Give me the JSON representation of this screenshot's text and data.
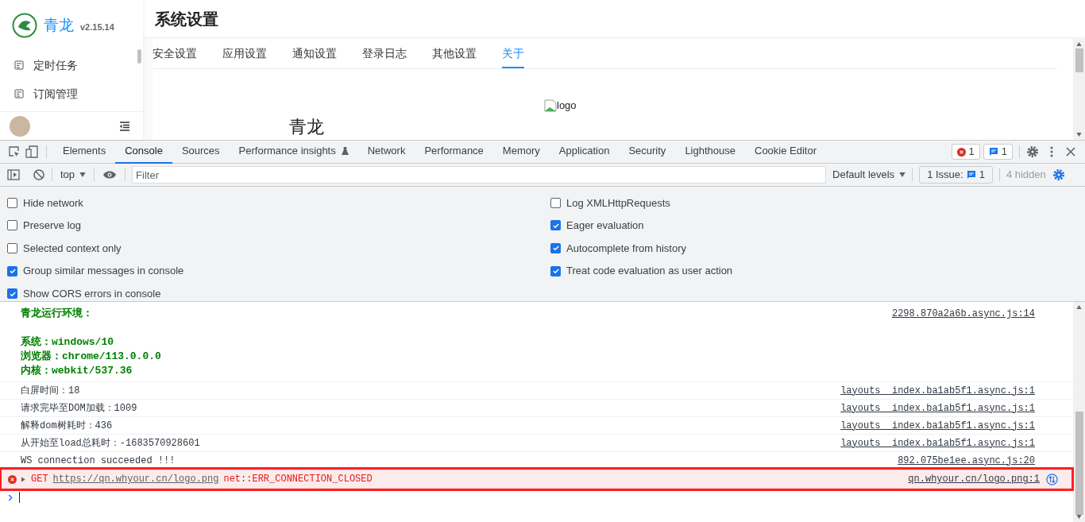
{
  "app": {
    "logo_text": "青龙",
    "version": "v2.15.14",
    "nav": [
      {
        "label": "定时任务"
      },
      {
        "label": "订阅管理"
      }
    ],
    "page_title": "系统设置",
    "tabs": [
      {
        "label": "安全设置",
        "selected": false
      },
      {
        "label": "应用设置",
        "selected": false
      },
      {
        "label": "通知设置",
        "selected": false
      },
      {
        "label": "登录日志",
        "selected": false
      },
      {
        "label": "其他设置",
        "selected": false
      },
      {
        "label": "关于",
        "selected": true
      }
    ],
    "content": {
      "image_alt": "logo",
      "heading": "青龙"
    }
  },
  "devtools": {
    "tabs": [
      {
        "label": "Elements",
        "selected": false
      },
      {
        "label": "Console",
        "selected": true
      },
      {
        "label": "Sources",
        "selected": false
      },
      {
        "label": "Performance insights",
        "selected": false,
        "experimental": true
      },
      {
        "label": "Network",
        "selected": false
      },
      {
        "label": "Performance",
        "selected": false
      },
      {
        "label": "Memory",
        "selected": false
      },
      {
        "label": "Application",
        "selected": false
      },
      {
        "label": "Security",
        "selected": false
      },
      {
        "label": "Lighthouse",
        "selected": false
      },
      {
        "label": "Cookie Editor",
        "selected": false
      }
    ],
    "error_count": "1",
    "message_count": "1",
    "toolbar": {
      "context": "top",
      "filter_placeholder": "Filter",
      "levels": "Default levels",
      "issues_label": "1 Issue:",
      "issues_count": "1",
      "hidden": "4 hidden"
    },
    "settings_left": [
      {
        "label": "Hide network",
        "checked": false
      },
      {
        "label": "Preserve log",
        "checked": false
      },
      {
        "label": "Selected context only",
        "checked": false
      },
      {
        "label": "Group similar messages in console",
        "checked": true
      },
      {
        "label": "Show CORS errors in console",
        "checked": true
      }
    ],
    "settings_right": [
      {
        "label": "Log XMLHttpRequests",
        "checked": false
      },
      {
        "label": "Eager evaluation",
        "checked": true
      },
      {
        "label": "Autocomplete from history",
        "checked": true
      },
      {
        "label": "Treat code evaluation as user action",
        "checked": true
      }
    ],
    "messages": [
      {
        "kind": "env",
        "lines": [
          "青龙运行环境：",
          "系统：windows/10",
          "浏览器：chrome/113.0.0.0",
          "内核：webkit/537.36"
        ],
        "source": "2298.870a2a6b.async.js:14"
      },
      {
        "kind": "log",
        "text": "白屏时间：18",
        "source": "layouts__index.ba1ab5f1.async.js:1"
      },
      {
        "kind": "log",
        "text": "请求完毕至DOM加载：1009",
        "source": "layouts__index.ba1ab5f1.async.js:1"
      },
      {
        "kind": "log",
        "text": "解释dom树耗时：436",
        "source": "layouts__index.ba1ab5f1.async.js:1"
      },
      {
        "kind": "log",
        "text": "从开始至load总耗时：-1683570928601",
        "source": "layouts__index.ba1ab5f1.async.js:1"
      },
      {
        "kind": "log",
        "text": "WS connection succeeded !!!",
        "source": "892.075be1ee.async.js:20"
      },
      {
        "kind": "error",
        "method": "GET",
        "url": "https://qn.whyour.cn/logo.png",
        "error": "net::ERR_CONNECTION_CLOSED",
        "source": "qn.whyour.cn/logo.png:1",
        "highlighted": true
      }
    ]
  }
}
